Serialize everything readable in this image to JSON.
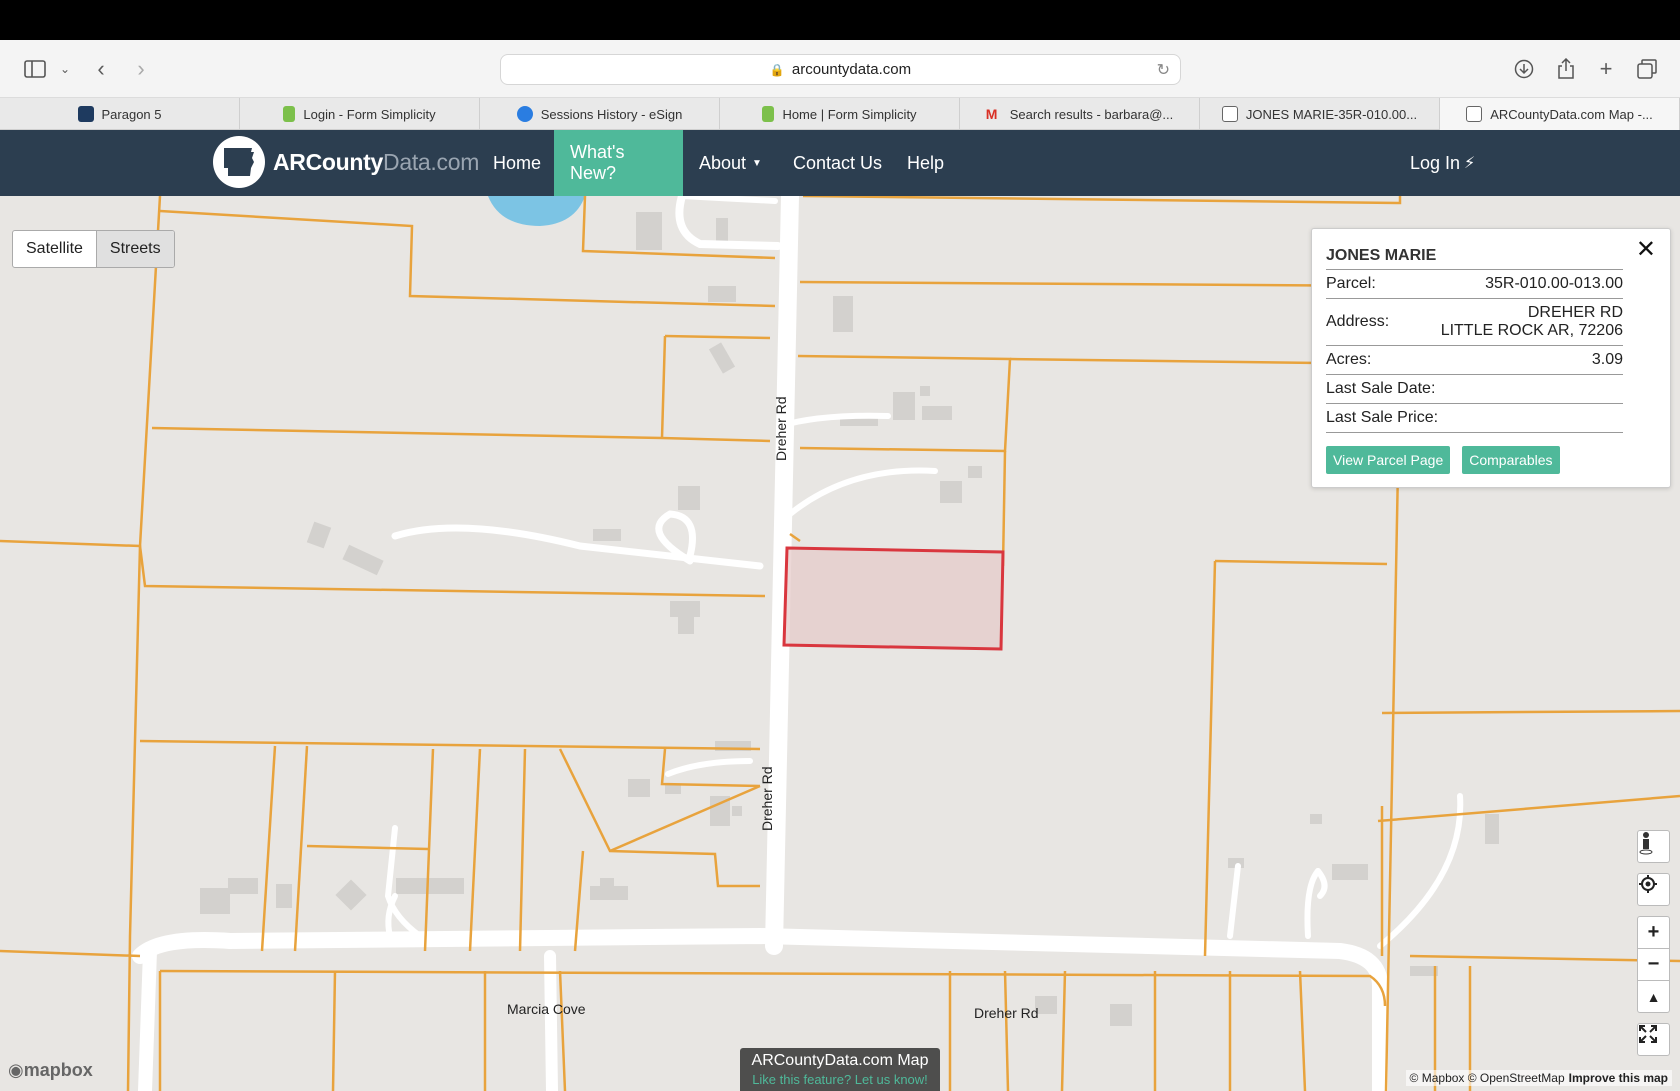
{
  "browser": {
    "url": "arcountydata.com",
    "tabs": [
      {
        "label": "Paragon 5",
        "icon": "paragon-icon",
        "color": "#1e3a5f"
      },
      {
        "label": "Login - Form Simplicity",
        "icon": "document-icon",
        "color": "#7cc04b"
      },
      {
        "label": "Sessions History - eSign",
        "icon": "esign-icon",
        "color": "#2a7de1"
      },
      {
        "label": "Home | Form Simplicity",
        "icon": "document-icon",
        "color": "#7cc04b"
      },
      {
        "label": "Search results - barbara@...",
        "icon": "gmail-icon",
        "color": "#d93025"
      },
      {
        "label": "JONES MARIE-35R-010.00...",
        "icon": "map-icon",
        "color": "#666666"
      },
      {
        "label": "ARCountyData.com Map -...",
        "icon": "map-icon",
        "color": "#666666"
      }
    ],
    "active_tab_index": 6
  },
  "site": {
    "logo_main": "ARCounty",
    "logo_dim": "Data.com",
    "nav": {
      "home": "Home",
      "whats_new": "What's New?",
      "about": "About",
      "contact": "Contact Us",
      "help": "Help",
      "login": "Log In"
    },
    "accent_color": "#4fb99a",
    "nav_color": "#2c3e50"
  },
  "map": {
    "toggle": {
      "satellite": "Satellite",
      "streets": "Streets",
      "selected": "Streets"
    },
    "roads": {
      "dreher_top": "Dreher Rd",
      "dreher_mid": "Dreher Rd",
      "dreher_bottom": "Dreher Rd",
      "marcia": "Marcia Cove"
    },
    "popup": {
      "owner": "JONES MARIE",
      "parcel_label": "Parcel:",
      "parcel_value": "35R-010.00-013.00",
      "address_label": "Address:",
      "address_line1": "DREHER RD",
      "address_line2": "LITTLE ROCK AR, 72206",
      "acres_label": "Acres:",
      "acres_value": "3.09",
      "last_sale_date_label": "Last Sale Date:",
      "last_sale_date_value": "",
      "last_sale_price_label": "Last Sale Price:",
      "last_sale_price_value": "",
      "view_button": "View Parcel Page",
      "comparables_button": "Comparables"
    },
    "promo": {
      "title": "ARCountyData.com Map",
      "subtitle": "Like this feature? Let us know!"
    },
    "mapbox_logo": "mapbox",
    "attribution": "© Mapbox © OpenStreetMap",
    "improve": "Improve this map",
    "parcel_line_color": "#e8a33d",
    "selected_parcel_color": "#d9363e"
  }
}
